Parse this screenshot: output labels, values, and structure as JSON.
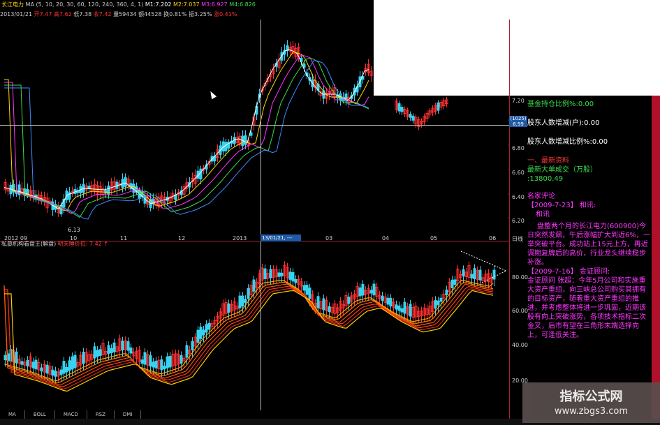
{
  "app": {
    "title": "长江电力",
    "ma_legend": "MA (5, 10, 20, 30, 60, 120, 240, 360, 4, 1)",
    "m1": "M1:7.202",
    "m2": "M2:7.037",
    "m3": "M3:6.927",
    "m4": "M4:6.826"
  },
  "info": {
    "date": "2013/01/21",
    "open": "开7.47",
    "high": "高7.62",
    "low": "低7.38",
    "close": "收7.42",
    "volume": "量59434",
    "amount": "额44528",
    "turnover": "换0.81%",
    "amplitude": "振3.25%",
    "change": "涨0.41%"
  },
  "chart_labels": {
    "low_marker": "6.13",
    "x_ticks": [
      "2012 09",
      "10",
      "11",
      "12",
      "2013",
      "03",
      "04",
      "05",
      "06"
    ],
    "period": "日线",
    "date_highlight": "13/01/21, ---",
    "price_ticks": [
      "7.20",
      "6.99",
      "6.80",
      "6.60",
      "6.40",
      "6.20"
    ],
    "price_box_top": "(1025)",
    "price_box_bottom": "6.99",
    "indicator_ticks": [
      "80.00",
      "60.00",
      "40.00",
      "20.00"
    ]
  },
  "indicator": {
    "name": "私募机构看盘王(解盘)",
    "line": "明天睡价位: 7.42 ↑"
  },
  "tabs": [
    "MA",
    "BOLL",
    "MACD",
    "RSZ",
    "DMI"
  ],
  "info_panel": {
    "fund_ratio": "基金持仓比例%:0.00",
    "holders_change": "股东人数增减(户):0.00",
    "holders_change_ratio": "股东人数增减比例%:0.00",
    "latest_header": "一、最新资料",
    "big_order_label": "最新大单成交（万股）",
    "big_order_value": ":13800.49",
    "comments_header": "名家评论",
    "comment1_date": "【2009-7-23】  和讯:",
    "comment1_src": "和讯",
    "comment1_text": "盘整两个月的长江电力(600900)今日突然发飙，午后涨幅扩大到近6%，一举突破平台。成功站上15元上方，再近调期复牌后的高价，行业龙头继续稳步补涨。",
    "comment2_date": "【2009-7-16】  金证顾问:",
    "comment2_text": "金证顾问 张超：今年5月公司和实施重大资产重组，向三峡总公司购买其拥有的目标资产，随着重大资产重组的推进，并考虑整体将进一步巩固，近期该股有向上突破涨势，各项技术指标二次金叉，后市有望在三角形末端选择向上，可逢低关注。"
  },
  "watermark": {
    "title": "指标公式网",
    "url": "www.zbgs3.com"
  },
  "colors": {
    "up_candle": "#ff3030",
    "down_candle": "#37d2f0",
    "panel_green": "#3bdc4b",
    "panel_magenta": "#ff36ff"
  }
}
